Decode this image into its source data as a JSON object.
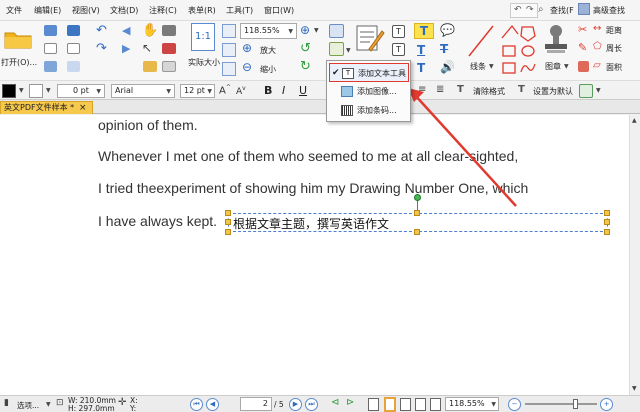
{
  "menu": {
    "items": [
      "文件",
      "编辑(E)",
      "视图(V)",
      "文档(D)",
      "注释(C)",
      "表单(R)",
      "工具(T)",
      "窗口(W)"
    ],
    "find": "查找(F",
    "advanced_search": "高级查找"
  },
  "ribbon": {
    "open_label": "打开(O)...",
    "zoom_value": "118.55%",
    "actual_size": "实际大小",
    "zoom_in": "放大",
    "zoom_out": "缩小",
    "line_label": "线条",
    "stamp_label": "图章",
    "distance": "距离",
    "perimeter": "周长",
    "area": "面积",
    "text_tool_letter": "T"
  },
  "format": {
    "line_width": "0 pt",
    "font_name": "Arial",
    "font_size": "12 pt",
    "bold": "B",
    "italic": "I",
    "underline": "U",
    "clear_format": "清除格式",
    "set_default": "设置为默认"
  },
  "tabs": {
    "document": "英文PDF文件样本 *",
    "close": "×"
  },
  "document": {
    "lines": [
      "opinion of them.",
      "Whenever I met one of them who seemed to me at all clear-sighted,",
      "I tried theexperiment of showing him my Drawing Number One, which",
      "I have always kept."
    ],
    "textbox": "根据文章主题，撰写英语作文"
  },
  "dropdown": {
    "items": [
      {
        "label": "添加文本工具",
        "checked": true
      },
      {
        "label": "添加图像...",
        "checked": false
      },
      {
        "label": "添加条码...",
        "checked": false
      }
    ]
  },
  "status": {
    "select_label": "选项...",
    "width": "W: 210.0mm",
    "height": "H: 297.0mm",
    "x_label": "X:",
    "y_label": "Y:",
    "page_value": "2",
    "page_total": "/ 5",
    "zoom": "118.55%"
  },
  "colors": {
    "accent_red": "#e03a2f",
    "tab_yellow": "#f6c84c",
    "link_blue": "#2f6cc0"
  }
}
